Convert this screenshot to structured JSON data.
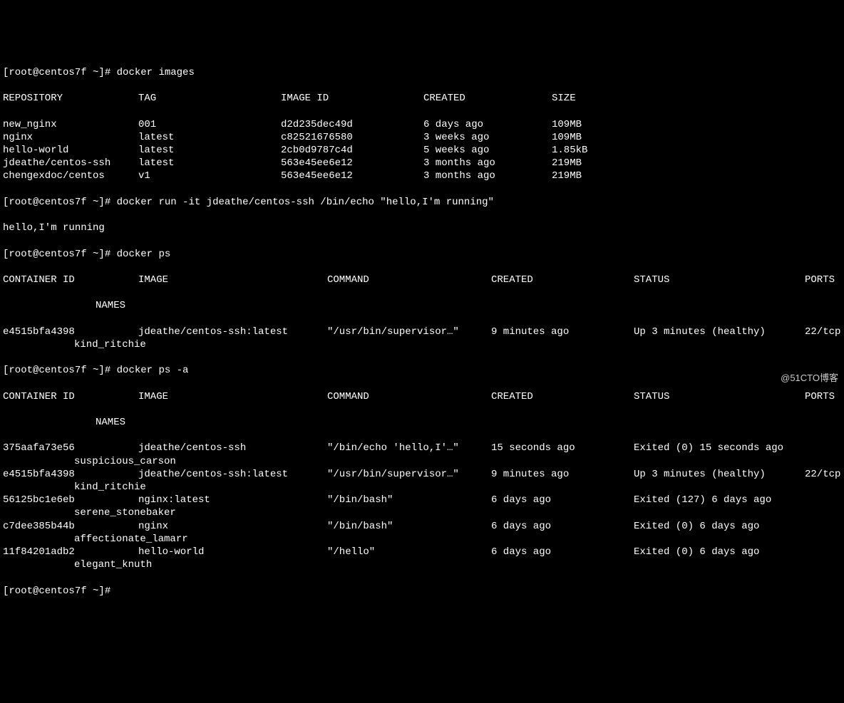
{
  "prompt": "[root@centos7f ~]# ",
  "commands": {
    "cmd1": "docker images",
    "cmd2": "docker run -it jdeathe/centos-ssh /bin/echo \"hello,I'm running\"",
    "cmd2_output": "hello,I'm running",
    "cmd3": "docker ps",
    "cmd4": "docker ps -a",
    "cmd5": ""
  },
  "images_header": {
    "repo": "REPOSITORY",
    "tag": "TAG",
    "image_id": "IMAGE ID",
    "created": "CREATED",
    "size": "SIZE"
  },
  "images": [
    {
      "repo": "new_nginx",
      "tag": "001",
      "image_id": "d2d235dec49d",
      "created": "6 days ago",
      "size": "109MB"
    },
    {
      "repo": "nginx",
      "tag": "latest",
      "image_id": "c82521676580",
      "created": "3 weeks ago",
      "size": "109MB"
    },
    {
      "repo": "hello-world",
      "tag": "latest",
      "image_id": "2cb0d9787c4d",
      "created": "5 weeks ago",
      "size": "1.85kB"
    },
    {
      "repo": "jdeathe/centos-ssh",
      "tag": "latest",
      "image_id": "563e45ee6e12",
      "created": "3 months ago",
      "size": "219MB"
    },
    {
      "repo": "chengexdoc/centos",
      "tag": "v1",
      "image_id": "563e45ee6e12",
      "created": "3 months ago",
      "size": "219MB"
    }
  ],
  "ps_header": {
    "container_id": "CONTAINER ID",
    "image": "IMAGE",
    "command": "COMMAND",
    "created": "CREATED",
    "status": "STATUS",
    "ports": "PORTS",
    "names": "NAMES"
  },
  "ps_rows": [
    {
      "id": "e4515bfa4398",
      "image": "jdeathe/centos-ssh:latest",
      "command": "\"/usr/bin/supervisor…\"",
      "created": "9 minutes ago",
      "status": "Up 3 minutes (healthy)",
      "ports": "22/tcp",
      "names": "kind_ritchie"
    }
  ],
  "psa_rows": [
    {
      "id": "375aafa73e56",
      "image": "jdeathe/centos-ssh",
      "command": "\"/bin/echo 'hello,I'…\"",
      "created": "15 seconds ago",
      "status": "Exited (0) 15 seconds ago",
      "ports": "",
      "names": "suspicious_carson"
    },
    {
      "id": "e4515bfa4398",
      "image": "jdeathe/centos-ssh:latest",
      "command": "\"/usr/bin/supervisor…\"",
      "created": "9 minutes ago",
      "status": "Up 3 minutes (healthy)",
      "ports": "22/tcp",
      "names": "kind_ritchie"
    },
    {
      "id": "56125bc1e6eb",
      "image": "nginx:latest",
      "command": "\"/bin/bash\"",
      "created": "6 days ago",
      "status": "Exited (127) 6 days ago",
      "ports": "",
      "names": "serene_stonebaker"
    },
    {
      "id": "c7dee385b44b",
      "image": "nginx",
      "command": "\"/bin/bash\"",
      "created": "6 days ago",
      "status": "Exited (0) 6 days ago",
      "ports": "",
      "names": "affectionate_lamarr"
    },
    {
      "id": "11f84201adb2",
      "image": "hello-world",
      "command": "\"/hello\"",
      "created": "6 days ago",
      "status": "Exited (0) 6 days ago",
      "ports": "",
      "names": "elegant_knuth"
    }
  ],
  "watermark": "@51CTO博客"
}
